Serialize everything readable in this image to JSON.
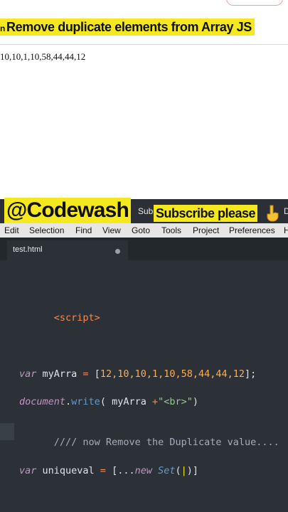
{
  "browser": {
    "title_prefix": "n",
    "video_title": "Remove duplicate elements from Array JS",
    "output_text": "10,10,1,10,58,44,44,12"
  },
  "banner": {
    "channel": "@Codewash",
    "sub_ghost": "Sub",
    "subscribe": "Subscribe please",
    "icon": "pointing-down-hand-icon",
    "edge_char": "D"
  },
  "menu": {
    "items": [
      "Edit",
      "Selection",
      "Find",
      "View",
      "Goto",
      "Tools",
      "Project",
      "Preferences",
      "H"
    ]
  },
  "tab": {
    "label": "test.html",
    "dirty_indicator": "dot-icon"
  },
  "code": {
    "line1": "<script>",
    "line2": {
      "kw": "var",
      "ident": " myArra ",
      "op": "=",
      "rest_open": " [",
      "values": "12,10,10,1,10,58,44,44,12",
      "rest_close": "];"
    },
    "line3": {
      "obj": "document",
      "dot": ".",
      "fn": "write",
      "args_a": "( myArra ",
      "plus": "+",
      "str": "\"<br>\"",
      "close": ")"
    },
    "line4": "//// now Remove the Duplicate value....",
    "line5": {
      "kw": "var",
      "ident": " uniqueval ",
      "op": "=",
      "open": " [...",
      "new": "new",
      "cls": " Set",
      "paren": "(",
      "caret": "|",
      "close": ")]"
    }
  },
  "colors": {
    "highlight": "#f6e81f",
    "editor_bg": "#2b3137",
    "tag": "#f28b54",
    "keyword": "#c594c5",
    "number": "#f9ae58",
    "string": "#99c794",
    "function": "#6699cc"
  }
}
